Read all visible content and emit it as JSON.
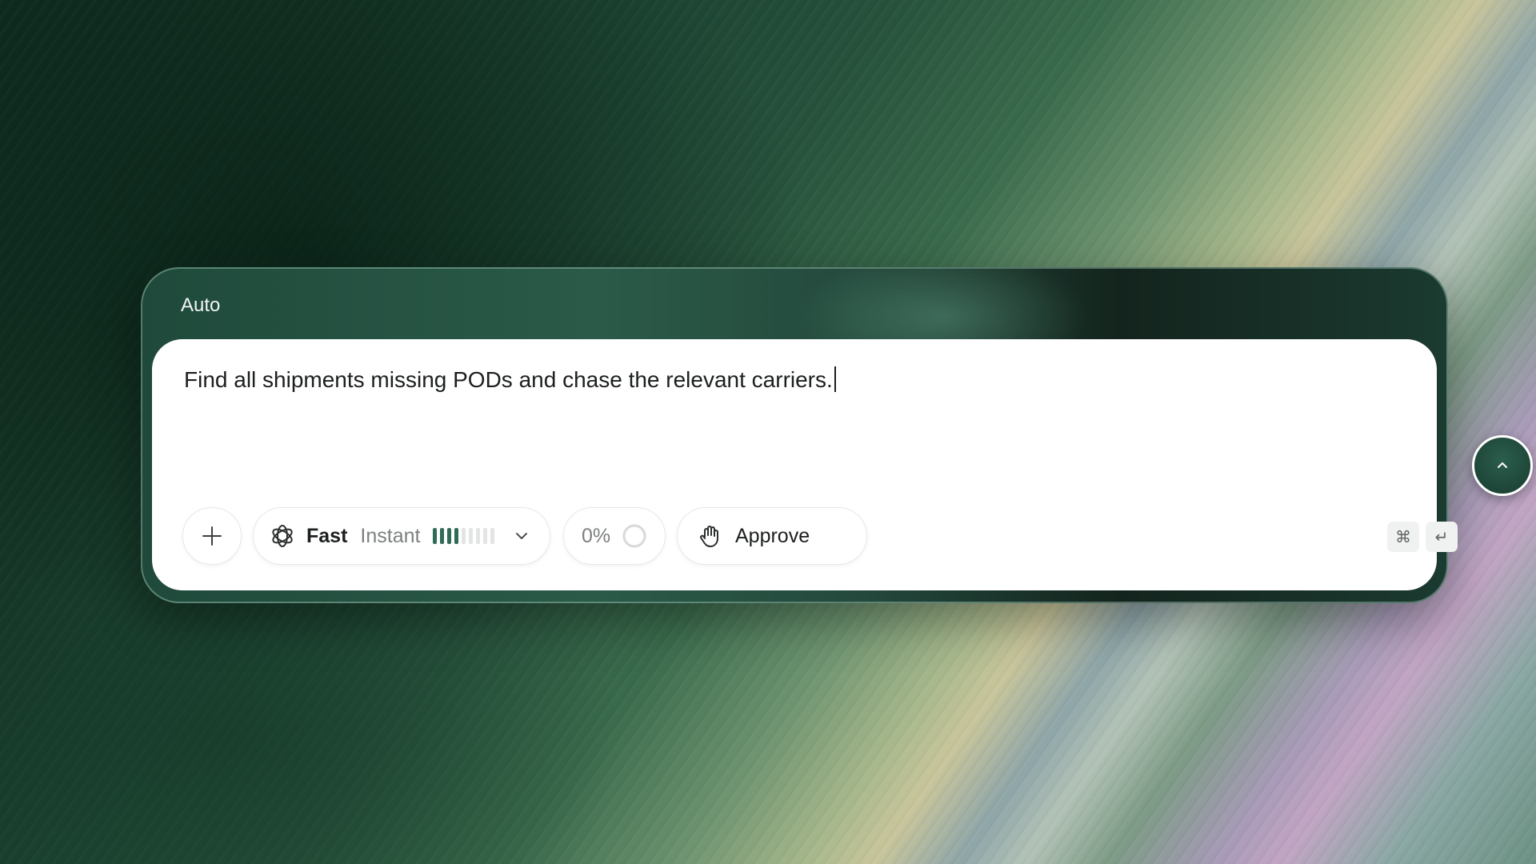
{
  "composer": {
    "mode_label": "Auto",
    "prompt_text": "Find all shipments missing PODs and chase the relevant carriers.",
    "toolbar": {
      "add_icon": "plus-icon",
      "model": {
        "icon": "openai-logo-icon",
        "name": "Fast",
        "speed": "Instant",
        "level_filled": 4,
        "level_total": 9,
        "dropdown_icon": "chevron-down-icon"
      },
      "context_usage": {
        "percent_label": "0%",
        "percent": 0,
        "icon": "progress-ring-icon"
      },
      "approval": {
        "icon": "hand-icon",
        "label": "Approve"
      },
      "shortcut_keys": [
        "⌘",
        "↵"
      ],
      "send_icon": "chevron-up-icon"
    }
  },
  "colors": {
    "accent": "#2f6b57",
    "shell": "#1f4a3b",
    "send_button": "#1e4638"
  }
}
